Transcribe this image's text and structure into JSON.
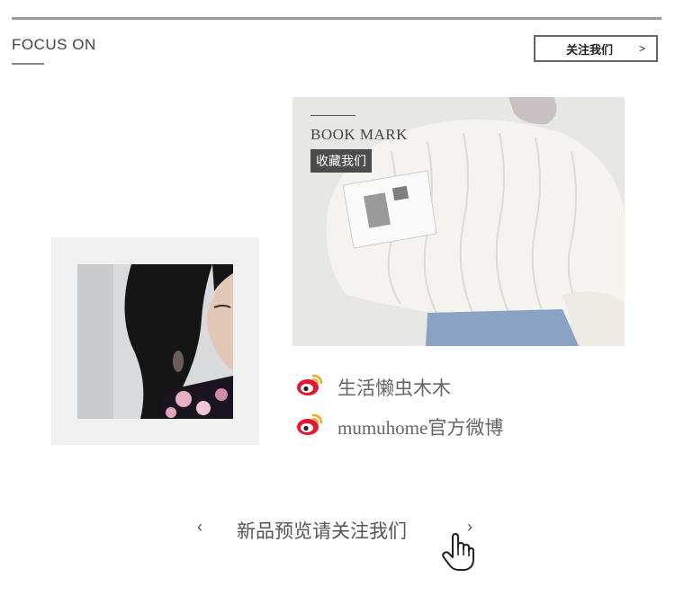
{
  "header": {
    "title": "FOCUS ON",
    "follow_button": {
      "label": "关注我们",
      "arrow": ">"
    }
  },
  "bookmark": {
    "title": "BOOK MARK",
    "badge": "收藏我们"
  },
  "social_links": [
    {
      "icon": "weibo-icon",
      "label": "生活懒虫木木"
    },
    {
      "icon": "weibo-icon",
      "label": "mumuhome官方微博"
    }
  ],
  "footer_nav": {
    "prev": "‹",
    "text": "新品预览请关注我们",
    "next": "›",
    "pointer_icon": "hand-pointer-icon"
  },
  "colors": {
    "weibo_red": "#e6162d",
    "weibo_orange": "#f5a623",
    "rule_gray": "#9a9a9a",
    "badge_bg": "#4c4c4c"
  }
}
